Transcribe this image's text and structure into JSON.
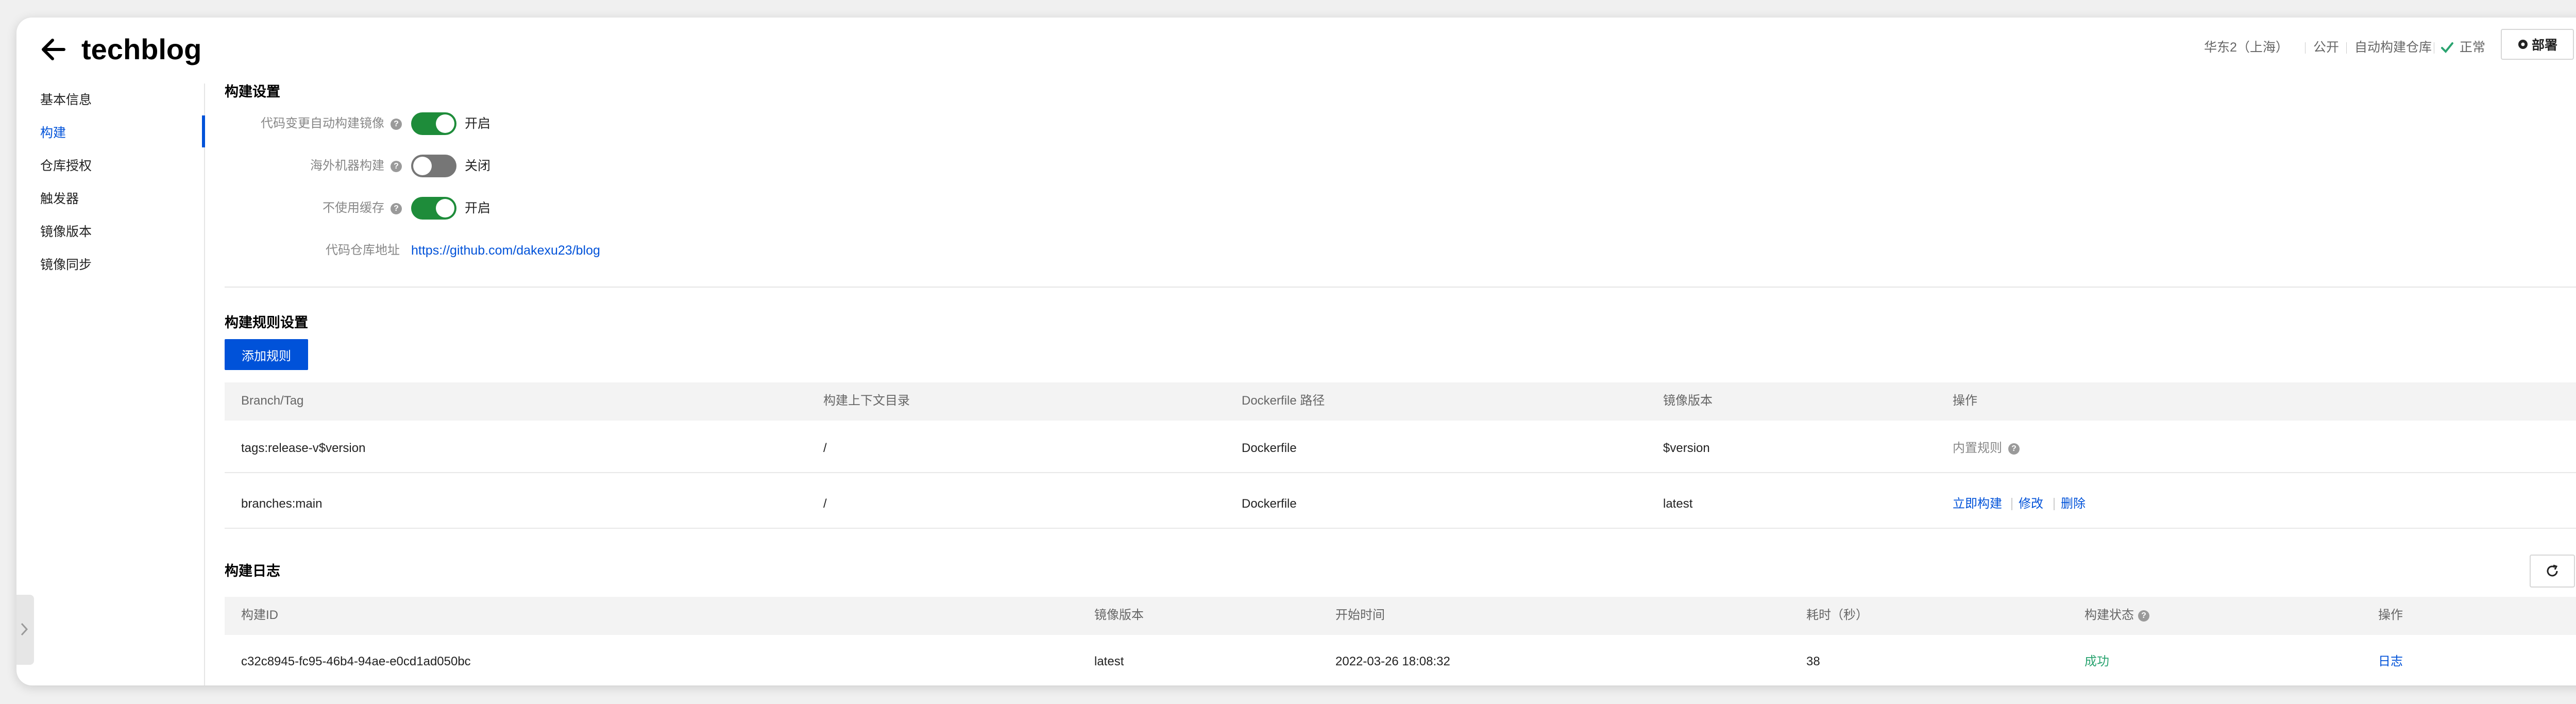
{
  "header": {
    "title": "techblog",
    "region": "华东2（上海）",
    "visibility": "公开",
    "repo_type": "自动构建仓库",
    "status": "正常",
    "deploy_label": "部署"
  },
  "sidebar": {
    "items": [
      {
        "label": "基本信息"
      },
      {
        "label": "构建"
      },
      {
        "label": "仓库授权"
      },
      {
        "label": "触发器"
      },
      {
        "label": "镜像版本"
      },
      {
        "label": "镜像同步"
      }
    ]
  },
  "build_settings": {
    "title": "构建设置",
    "auto_build": {
      "label": "代码变更自动构建镜像",
      "state": "开启",
      "on": true
    },
    "overseas": {
      "label": "海外机器构建",
      "state": "关闭",
      "on": false
    },
    "no_cache": {
      "label": "不使用缓存",
      "state": "开启",
      "on": true
    },
    "repo_url_label": "代码仓库地址",
    "repo_url": "https://github.com/dakexu23/blog"
  },
  "rules": {
    "title": "构建规则设置",
    "add_label": "添加规则",
    "columns": [
      "Branch/Tag",
      "构建上下文目录",
      "Dockerfile 路径",
      "镜像版本",
      "操作"
    ],
    "rows": [
      {
        "ref": "tags:release-v$version",
        "context": "/",
        "dockerfile": "Dockerfile",
        "version": "$version",
        "op": "内置规则"
      },
      {
        "ref": "branches:main",
        "context": "/",
        "dockerfile": "Dockerfile",
        "version": "latest",
        "ops": [
          "立即构建",
          "修改",
          "删除"
        ]
      }
    ]
  },
  "logs": {
    "title": "构建日志",
    "columns": [
      "构建ID",
      "镜像版本",
      "开始时间",
      "耗时（秒）",
      "构建状态",
      "操作"
    ],
    "rows": [
      {
        "id": "c32c8945-fc95-46b4-94ae-e0cd1ad050bc",
        "version": "latest",
        "start": "2022-03-26 18:08:32",
        "duration": "38",
        "status": "成功",
        "op": "日志"
      }
    ]
  },
  "colors": {
    "accent": "#0052d9",
    "toggle_on": "#1e8c3a",
    "success": "#2ba471"
  }
}
